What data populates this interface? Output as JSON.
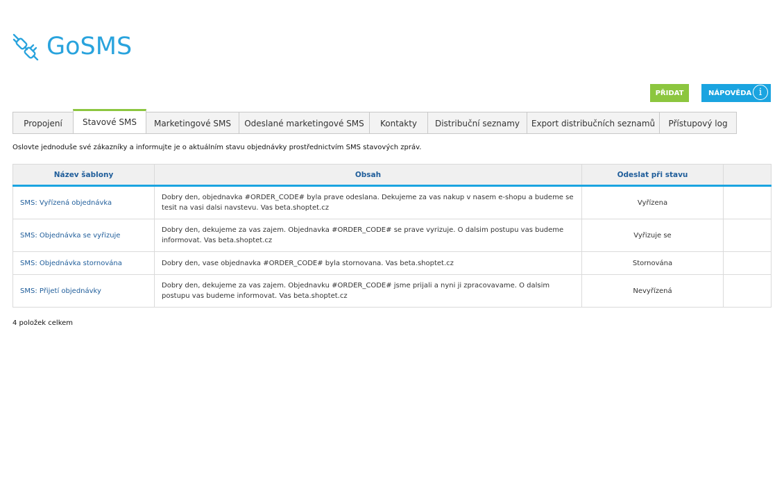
{
  "app": {
    "title": "GoSMS",
    "logo_icon": "plug-connector-icon",
    "brand_color": "#29a3dd"
  },
  "toolbar": {
    "add_label": "PŘIDAT",
    "help_label": "NÁPOVĚDA",
    "help_icon": "info-icon"
  },
  "tabs": [
    {
      "label": "Propojení"
    },
    {
      "label": "Stavové SMS",
      "active": true
    },
    {
      "label": "Marketingové SMS"
    },
    {
      "label": "Odeslané marketingové SMS"
    },
    {
      "label": "Kontakty"
    },
    {
      "label": "Distribuční seznamy"
    },
    {
      "label": "Export distribučních seznamů"
    },
    {
      "label": "Přístupový log"
    }
  ],
  "intro": "Oslovte jednoduše své zákazníky a informujte je o aktuálním stavu objednávky prostřednictvím SMS stavových zpráv.",
  "table": {
    "headers": {
      "name": "Název šablony",
      "content": "Obsah",
      "state": "Odeslat při stavu",
      "actions": ""
    },
    "rows": [
      {
        "name": "SMS: Vyřízená objednávka",
        "content": "Dobry den, objednavka #ORDER_CODE# byla prave odeslana. Dekujeme za vas nakup v nasem e-shopu a budeme se tesit na vasi dalsi navstevu. Vas beta.shoptet.cz",
        "state": "Vyřízena"
      },
      {
        "name": "SMS: Objednávka se vyřizuje",
        "content": "Dobry den, dekujeme za vas zajem. Objednavka #ORDER_CODE# se prave vyrizuje. O dalsim postupu vas budeme informovat. Vas beta.shoptet.cz",
        "state": "Vyřizuje se"
      },
      {
        "name": "SMS: Objednávka stornována",
        "content": "Dobry den, vase objednavka #ORDER_CODE# byla stornovana. Vas beta.shoptet.cz",
        "state": "Stornována"
      },
      {
        "name": "SMS: Přijetí objednávky",
        "content": "Dobry den, dekujeme za vas zajem. Objednavku #ORDER_CODE# jsme prijali a nyni ji zpracovavame. O dalsim postupu vas budeme informovat. Vas beta.shoptet.cz",
        "state": "Nevyřízená"
      }
    ]
  },
  "total": "4 položek celkem"
}
